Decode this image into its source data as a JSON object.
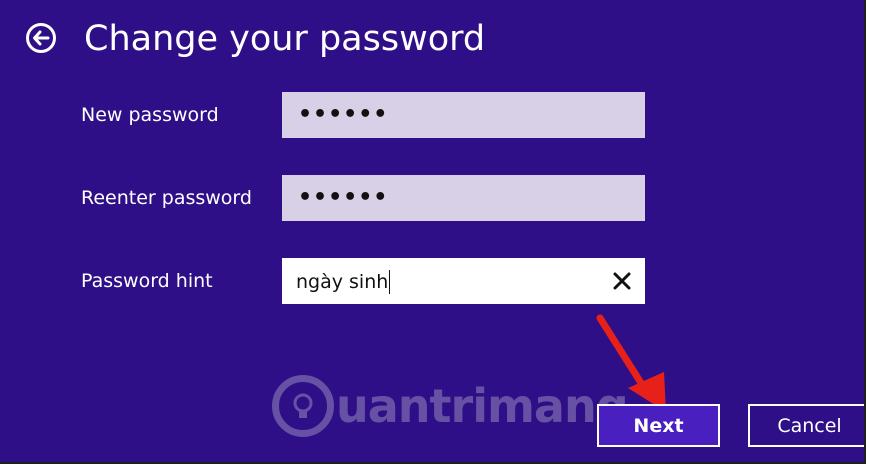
{
  "dialog": {
    "title": "Change your password",
    "background_color": "#2e0f87"
  },
  "fields": {
    "new_password": {
      "label": "New password",
      "value": "••••••"
    },
    "reenter_password": {
      "label": "Reenter password",
      "value": "••••••"
    },
    "password_hint": {
      "label": "Password hint",
      "value": "ngày sinh"
    }
  },
  "buttons": {
    "next": "Next",
    "cancel": "Cancel"
  },
  "icons": {
    "back": "back-arrow-circle-icon",
    "clear": "close-icon"
  },
  "watermark": {
    "text": "uantrimang"
  },
  "annotation": {
    "arrow_color": "#e8201a"
  }
}
